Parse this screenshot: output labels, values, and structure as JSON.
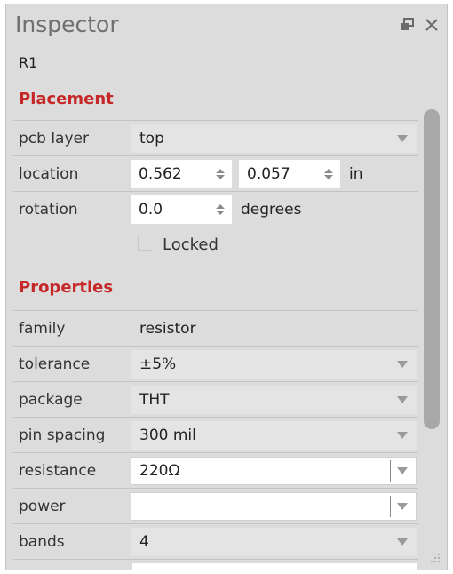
{
  "window": {
    "title": "Inspector",
    "subtitle": "R1",
    "float_icon": "float-window-icon",
    "close_icon": "close-icon"
  },
  "colors": {
    "section_header": "#c62828",
    "panel_bg": "#dcdcdc"
  },
  "placement": {
    "header": "Placement",
    "pcb_layer": {
      "label": "pcb layer",
      "value": "top"
    },
    "location": {
      "label": "location",
      "x": "0.562",
      "y": "0.057",
      "unit": "in"
    },
    "rotation": {
      "label": "rotation",
      "value": "0.0",
      "unit": "degrees"
    },
    "locked": {
      "label": "Locked",
      "checked": false
    }
  },
  "properties": {
    "header": "Properties",
    "family": {
      "label": "family",
      "value": "resistor"
    },
    "tolerance": {
      "label": "tolerance",
      "value": "±5%"
    },
    "package": {
      "label": "package",
      "value": "THT"
    },
    "pin_spacing": {
      "label": "pin spacing",
      "value": "300 mil"
    },
    "resistance": {
      "label": "resistance",
      "value": "220Ω"
    },
    "power": {
      "label": "power",
      "value": ""
    },
    "bands": {
      "label": "bands",
      "value": "4"
    }
  }
}
